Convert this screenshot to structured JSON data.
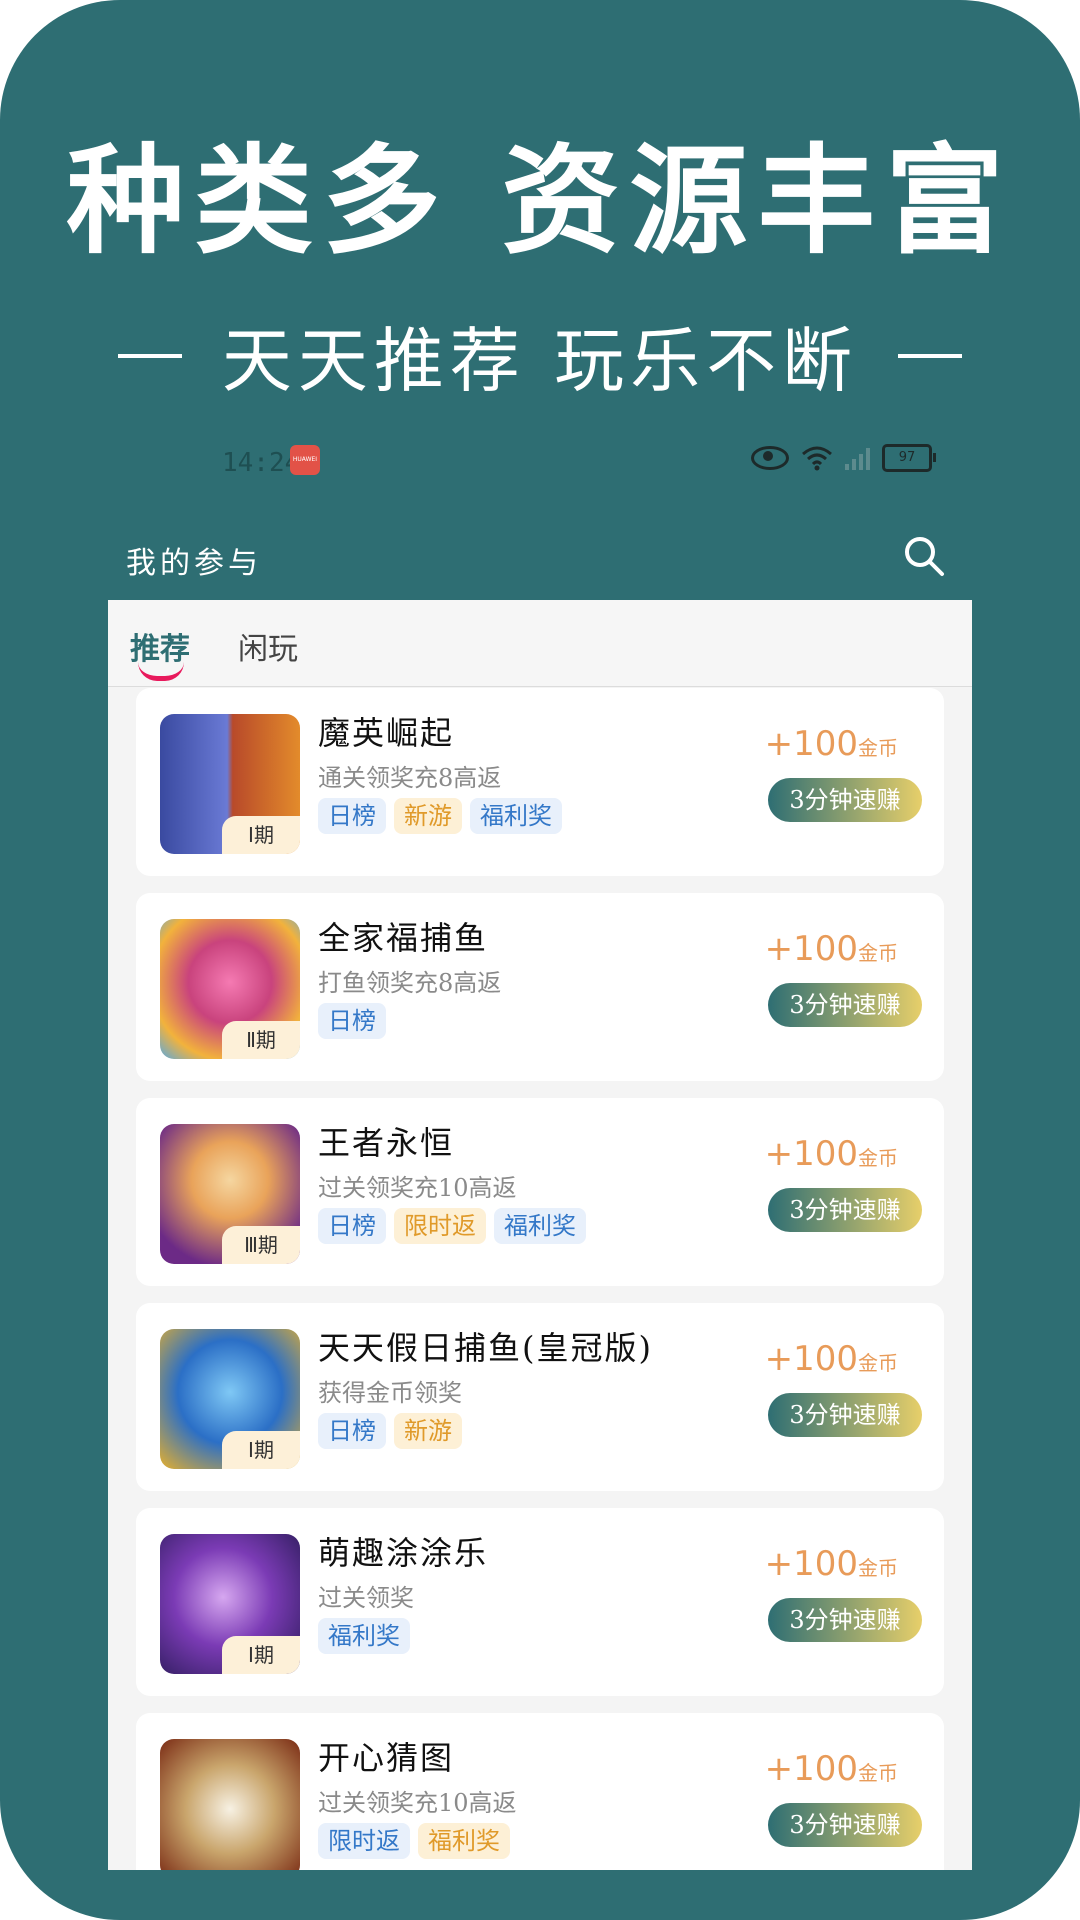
{
  "promo": {
    "headline": "种类多  资源丰富",
    "subline": "天天推荐  玩乐不断"
  },
  "status_bar": {
    "time": "14:24",
    "brand_badge": "HUAWEI",
    "battery": "97"
  },
  "app_bar": {
    "title": "我的参与"
  },
  "tabs": [
    {
      "label": "推荐",
      "active": true
    },
    {
      "label": "闲玩",
      "active": false
    }
  ],
  "colors": {
    "background": "#2e6e73",
    "tab_indicator": "#e8195c",
    "reward_text": "#e89b59",
    "tag_blue": "#3478c8",
    "tag_orange": "#e09a2a"
  },
  "games": [
    {
      "name": "魔英崛起",
      "desc": "通关领奖充8高返",
      "period": "Ⅰ期",
      "tags": [
        {
          "text": "日榜",
          "color": "blue"
        },
        {
          "text": "新游",
          "color": "orange"
        },
        {
          "text": "福利奖",
          "color": "blue"
        }
      ],
      "reward_amount": "+100",
      "reward_unit": "金币",
      "button": "3分钟速赚"
    },
    {
      "name": "全家福捕鱼",
      "desc": "打鱼领奖充8高返",
      "period": "Ⅱ期",
      "tags": [
        {
          "text": "日榜",
          "color": "blue"
        }
      ],
      "reward_amount": "+100",
      "reward_unit": "金币",
      "button": "3分钟速赚"
    },
    {
      "name": "王者永恒",
      "desc": "过关领奖充10高返",
      "period": "Ⅲ期",
      "tags": [
        {
          "text": "日榜",
          "color": "blue"
        },
        {
          "text": "限时返",
          "color": "orange"
        },
        {
          "text": "福利奖",
          "color": "blue"
        }
      ],
      "reward_amount": "+100",
      "reward_unit": "金币",
      "button": "3分钟速赚"
    },
    {
      "name": "天天假日捕鱼(皇冠版)",
      "desc": "获得金币领奖",
      "period": "Ⅰ期",
      "tags": [
        {
          "text": "日榜",
          "color": "blue"
        },
        {
          "text": "新游",
          "color": "orange"
        }
      ],
      "reward_amount": "+100",
      "reward_unit": "金币",
      "button": "3分钟速赚"
    },
    {
      "name": "萌趣涂涂乐",
      "desc": "过关领奖",
      "period": "Ⅰ期",
      "tags": [
        {
          "text": "福利奖",
          "color": "blue"
        }
      ],
      "reward_amount": "+100",
      "reward_unit": "金币",
      "button": "3分钟速赚"
    },
    {
      "name": "开心猜图",
      "desc": "过关领奖充10高返",
      "period": "",
      "tags": [
        {
          "text": "限时返",
          "color": "blue"
        },
        {
          "text": "福利奖",
          "color": "orange"
        }
      ],
      "reward_amount": "+100",
      "reward_unit": "金币",
      "button": "3分钟速赚"
    }
  ]
}
